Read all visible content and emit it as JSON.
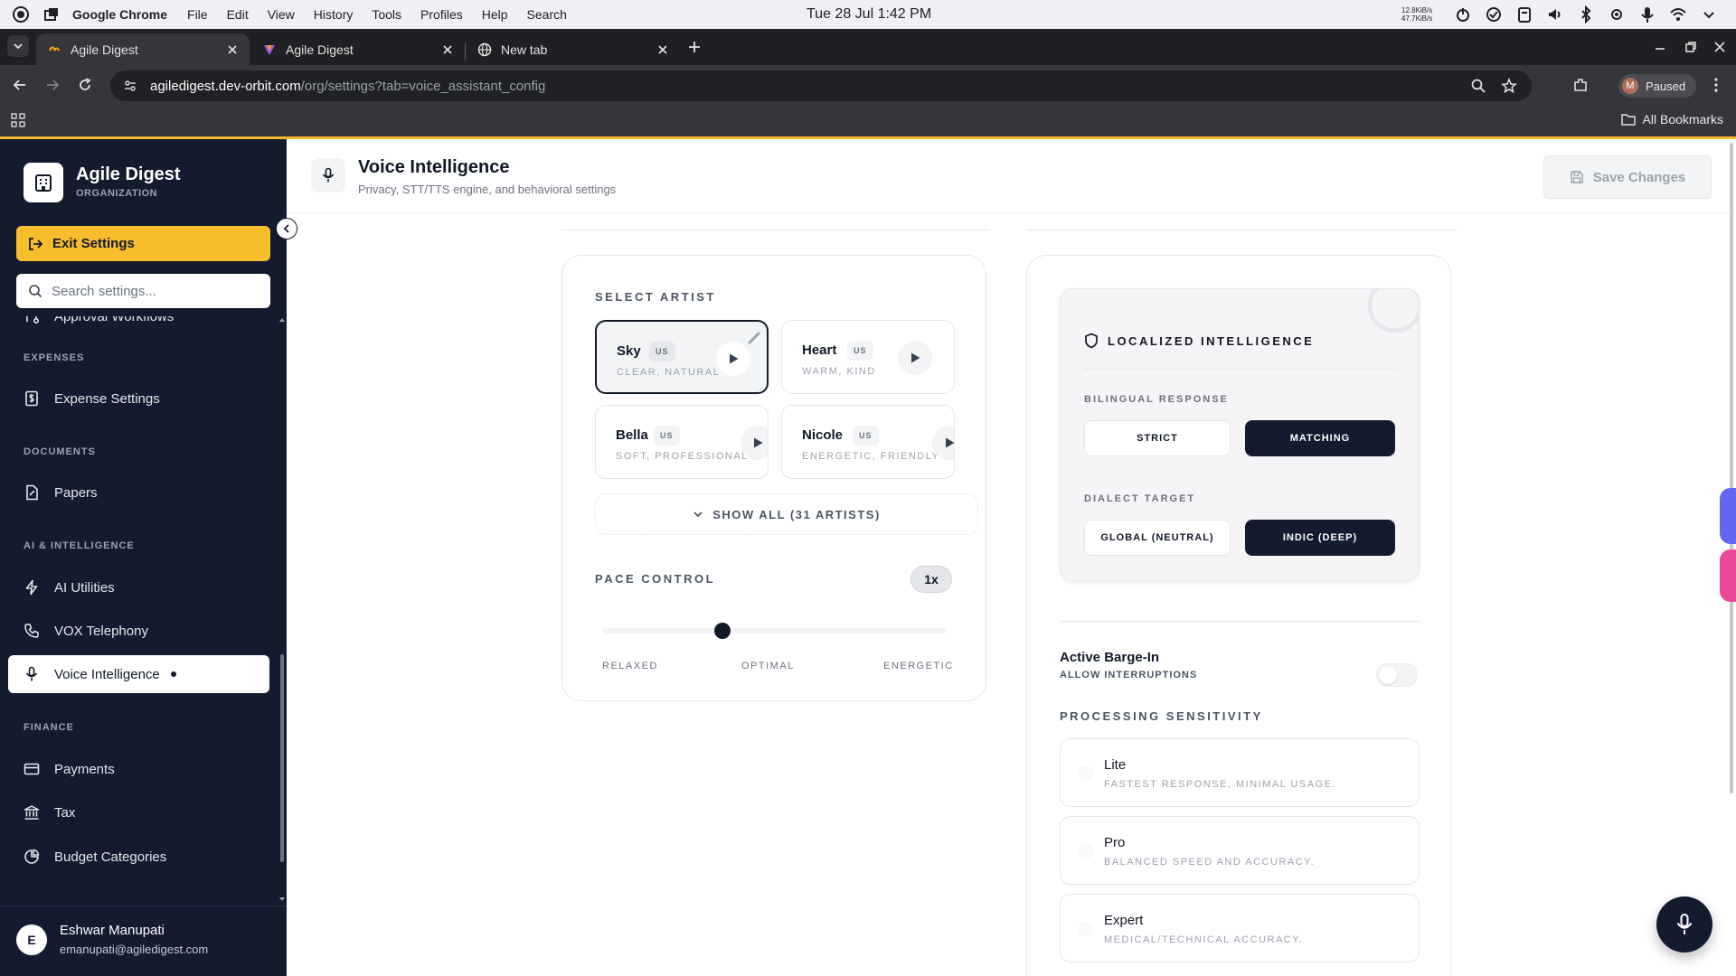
{
  "os": {
    "app_name": "Google Chrome",
    "menus": [
      "File",
      "Edit",
      "View",
      "History",
      "Tools",
      "Profiles",
      "Help",
      "Search"
    ],
    "clock": "Tue 28 Jul  1:42 PM",
    "net_up": "12.8KiB/s",
    "net_down": "47.7KiB/s"
  },
  "browser": {
    "tabs": [
      {
        "title": "Agile Digest",
        "active": true
      },
      {
        "title": "Agile Digest",
        "active": false
      },
      {
        "title": "New tab",
        "active": false
      }
    ],
    "url_host": "agiledigest.dev-orbit.com",
    "url_path": "/org/settings?tab=voice_assistant_config",
    "profile_initial": "M",
    "profile_status": "Paused",
    "bookmarks_label": "All Bookmarks"
  },
  "sidebar": {
    "org_name": "Agile Digest",
    "org_type": "ORGANIZATION",
    "exit_label": "Exit Settings",
    "search_placeholder": "Search settings...",
    "partial_item": "Approval Workflows",
    "sections": [
      {
        "title": "EXPENSES",
        "items": [
          {
            "label": "Expense Settings",
            "icon": "dollar-doc-icon"
          }
        ]
      },
      {
        "title": "DOCUMENTS",
        "items": [
          {
            "label": "Papers",
            "icon": "document-icon"
          }
        ]
      },
      {
        "title": "AI & INTELLIGENCE",
        "items": [
          {
            "label": "AI Utilities",
            "icon": "lightning-icon"
          },
          {
            "label": "VOX Telephony",
            "icon": "phone-icon"
          },
          {
            "label": "Voice Intelligence",
            "icon": "microphone-icon",
            "active": true
          }
        ]
      },
      {
        "title": "FINANCE",
        "items": [
          {
            "label": "Payments",
            "icon": "credit-card-icon"
          },
          {
            "label": "Tax",
            "icon": "bank-icon"
          },
          {
            "label": "Budget Categories",
            "icon": "pie-chart-icon"
          }
        ]
      }
    ],
    "user": {
      "initial": "E",
      "name": "Eshwar Manupati",
      "email": "emanupati@agiledigest.com"
    }
  },
  "header": {
    "title": "Voice Intelligence",
    "subtitle": "Privacy, STT/TTS engine, and behavioral settings",
    "save_label": "Save Changes"
  },
  "artists": {
    "heading": "SELECT ARTIST",
    "items": [
      {
        "name": "Sky",
        "region": "US",
        "traits": "CLEAR, NATURAL",
        "selected": true
      },
      {
        "name": "Heart",
        "region": "US",
        "traits": "WARM, KIND"
      },
      {
        "name": "Bella",
        "region": "US",
        "traits": "SOFT, PROFESSIONAL"
      },
      {
        "name": "Nicole",
        "region": "US",
        "traits": "ENERGETIC, FRIENDLY"
      }
    ],
    "show_all": "SHOW ALL (31 ARTISTS)"
  },
  "pace": {
    "heading": "PACE CONTROL",
    "value": "1x",
    "slider_fraction": 0.35,
    "labels": [
      "RELAXED",
      "OPTIMAL",
      "ENERGETIC"
    ]
  },
  "localized": {
    "heading": "LOCALIZED INTELLIGENCE",
    "bilingual_heading": "BILINGUAL RESPONSE",
    "bilingual_options": [
      "STRICT",
      "MATCHING"
    ],
    "bilingual_selected": "MATCHING",
    "dialect_heading": "DIALECT TARGET",
    "dialect_options": [
      "GLOBAL (NEUTRAL)",
      "INDIC (DEEP)"
    ],
    "dialect_selected": "INDIC (DEEP)"
  },
  "barge_in": {
    "title": "Active Barge-In",
    "subtitle": "ALLOW INTERRUPTIONS",
    "enabled": false
  },
  "sensitivity": {
    "heading": "PROCESSING SENSITIVITY",
    "options": [
      {
        "name": "Lite",
        "desc": "FASTEST RESPONSE, MINIMAL USAGE."
      },
      {
        "name": "Pro",
        "desc": "BALANCED SPEED AND ACCURACY."
      },
      {
        "name": "Expert",
        "desc": "MEDICAL/TECHNICAL ACCURACY."
      }
    ]
  }
}
